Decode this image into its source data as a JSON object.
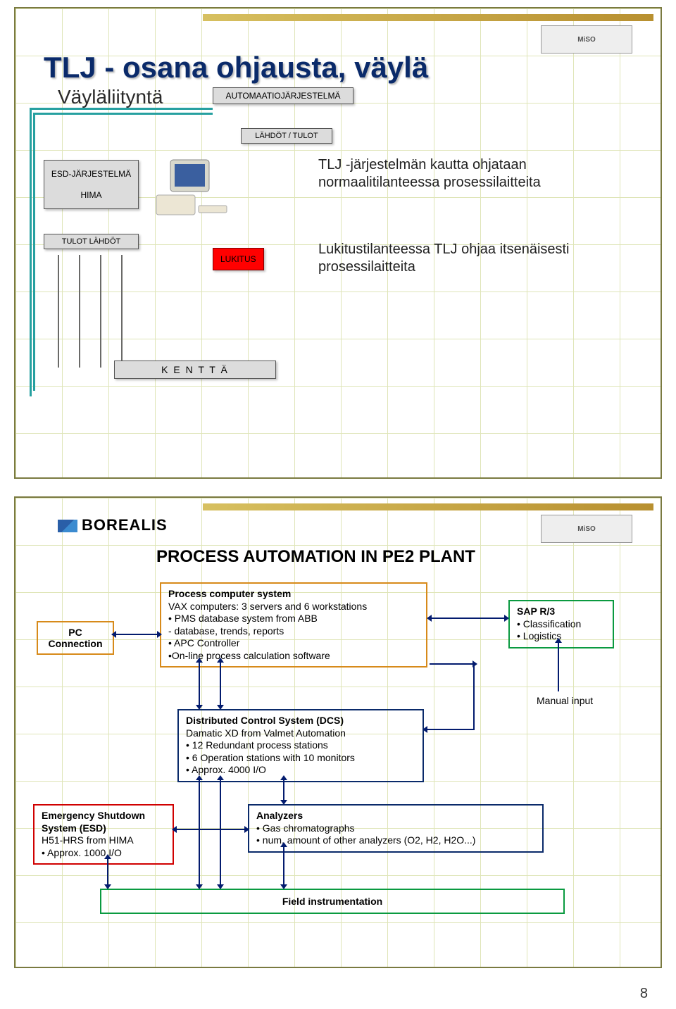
{
  "logo_text": "MiSO",
  "slide1": {
    "title": "TLJ - osana ohjausta, väylä",
    "subtitle": "Väyläliityntä",
    "auto_box": "AUTOMAATIOJÄRJESTELMÄ",
    "io_box": "LÄHDÖT / TULOT",
    "esd_label": "ESD-JÄRJESTELMÄ",
    "hima_label": "HIMA",
    "tulot_label": "TULOT  LÄHDÖT",
    "lukitus_box": "LUKITUS",
    "text1": "TLJ -järjestelmän kautta ohjataan normaalitilanteessa prosessilaitteita",
    "text2": "Lukitustilanteessa TLJ ohjaa itsenäisesti prosessilaitteita",
    "kentta_box": "K E N T T Ä"
  },
  "slide2": {
    "borealis": "BOREALIS",
    "title": "PROCESS AUTOMATION IN PE2 PLANT",
    "pc_box": "PC\nConnection",
    "process": {
      "heading": "Process computer system",
      "l1": "VAX computers: 3 servers and 6 workstations",
      "l2": "• PMS database system from ABB",
      "l3": "   - database, trends, reports",
      "l4": "• APC Controller",
      "l5": "•On-line process calculation software"
    },
    "sap": {
      "heading": "SAP R/3",
      "l1": "• Classification",
      "l2": "• Logistics"
    },
    "manual": "Manual input",
    "dcs": {
      "heading": "Distributed Control System (DCS)",
      "l1": "Damatic XD from Valmet Automation",
      "l2": "• 12 Redundant process stations",
      "l3": "• 6 Operation stations with 10 monitors",
      "l4": "• Approx. 4000  I/O"
    },
    "esd": {
      "heading": "Emergency Shutdown System (ESD)",
      "l1": "H51-HRS from HIMA",
      "l2": "• Approx. 1000 I/O"
    },
    "analyzers": {
      "heading": "Analyzers",
      "l1": "• Gas chromatographs",
      "l2": "• num. amount of other analyzers (O2, H2, H2O...)"
    },
    "field": "Field instrumentation"
  },
  "page_number": "8"
}
